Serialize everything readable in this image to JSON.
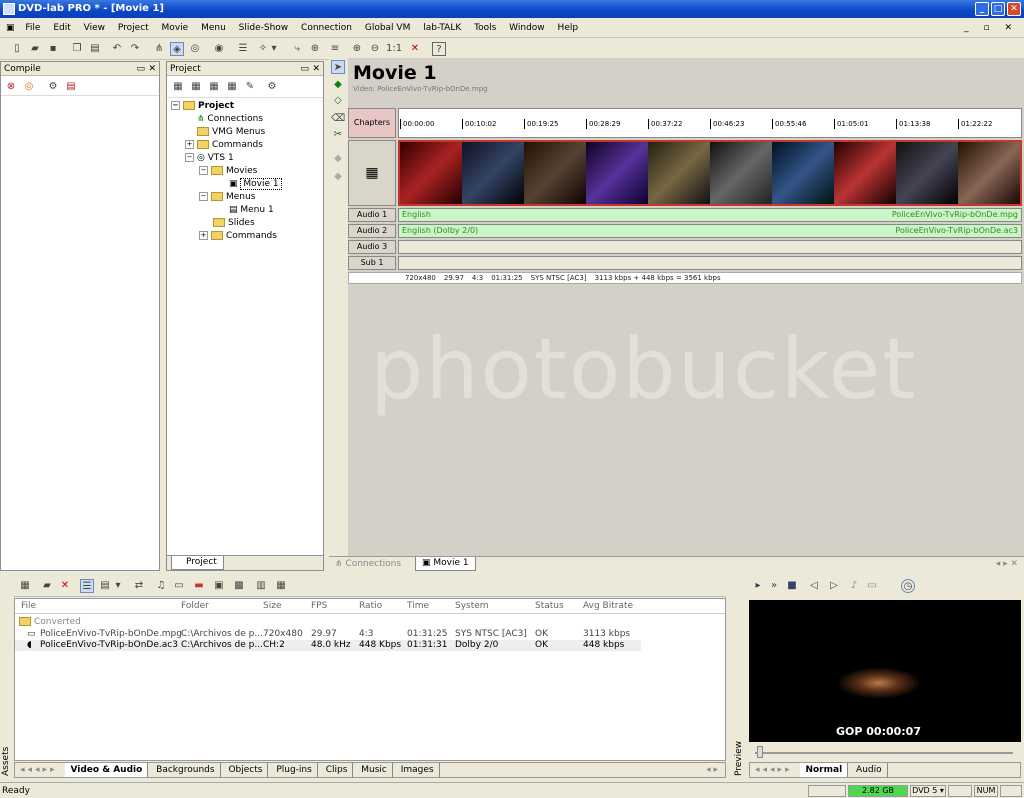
{
  "window": {
    "title": "DVD-lab PRO * - [Movie 1]"
  },
  "menu": [
    "File",
    "Edit",
    "View",
    "Project",
    "Movie",
    "Menu",
    "Slide-Show",
    "Connection",
    "Global VM",
    "lab-TALK",
    "Tools",
    "Window",
    "Help"
  ],
  "compile_panel": {
    "title": "Compile"
  },
  "project_panel": {
    "title": "Project",
    "tab": "Project",
    "tree": [
      {
        "label": "Project",
        "level": 0,
        "bold": true
      },
      {
        "label": "Connections",
        "level": 1
      },
      {
        "label": "VMG Menus",
        "level": 1
      },
      {
        "label": "Commands",
        "level": 1
      },
      {
        "label": "VTS 1",
        "level": 1
      },
      {
        "label": "Movies",
        "level": 2
      },
      {
        "label": "Movie 1",
        "level": 3
      },
      {
        "label": "Menus",
        "level": 2
      },
      {
        "label": "Menu 1",
        "level": 3
      },
      {
        "label": "Slides",
        "level": 2
      },
      {
        "label": "Commands",
        "level": 2
      }
    ]
  },
  "movie": {
    "title": "Movie 1",
    "subtitle": "Video: PoliceEnVivo-TvRip-bOnDe.mpg",
    "chapters_label": "Chapters",
    "ruler": [
      "00:00:00",
      "00:10:02",
      "00:19:25",
      "00:28:29",
      "00:37:22",
      "00:46:23",
      "00:55:46",
      "01:05:01",
      "01:13:38",
      "01:22:22"
    ],
    "tracks": [
      {
        "label": "Audio 1",
        "text": "English",
        "file": "PoliceEnVivo-TvRip-bOnDe.mpg",
        "active": true
      },
      {
        "label": "Audio 2",
        "text": "English (Dolby 2/0)",
        "file": "PoliceEnVivo-TvRip-bOnDe.ac3",
        "active": true
      },
      {
        "label": "Audio 3",
        "text": "",
        "file": "",
        "active": false
      },
      {
        "label": "Sub 1",
        "text": "",
        "file": "",
        "active": false
      }
    ],
    "info": [
      "720x480",
      "29.97",
      "4:3",
      "01:31:25",
      "SYS NTSC [AC3]",
      "3113 kbps + 448 kbps = 3561 kbps"
    ]
  },
  "doc_tabs": [
    "Connections",
    "Movie 1"
  ],
  "assets": {
    "side_label": "Assets",
    "columns": [
      "File",
      "Folder",
      "Size",
      "FPS",
      "Ratio",
      "Time",
      "System",
      "Status",
      "Avg Bitrate"
    ],
    "group": "Converted",
    "rows": [
      [
        "PoliceEnVivo-TvRip-bOnDe.mpg",
        "C:\\Archivos de p...",
        "720x480",
        "29.97",
        "4:3",
        "01:31:25",
        "SYS NTSC [AC3]",
        "OK",
        "3113 kbps"
      ],
      [
        "PoliceEnVivo-TvRip-bOnDe.ac3",
        "C:\\Archivos de p...",
        "CH:2",
        "48.0 kHz",
        "448 Kbps",
        "01:31:31",
        "Dolby 2/0",
        "OK",
        "448 kbps"
      ]
    ],
    "tabs": [
      "Video & Audio",
      "Backgrounds",
      "Objects",
      "Plug-ins",
      "Clips",
      "Music",
      "Images"
    ]
  },
  "preview": {
    "side_label": "Preview",
    "overlay": "GOP 00:00:07",
    "tabs": [
      "Normal",
      "Audio"
    ]
  },
  "status": {
    "text": "Ready",
    "disk": "2.82 GB",
    "media": "DVD 5",
    "num": "NUM"
  },
  "watermark": "photobucket"
}
